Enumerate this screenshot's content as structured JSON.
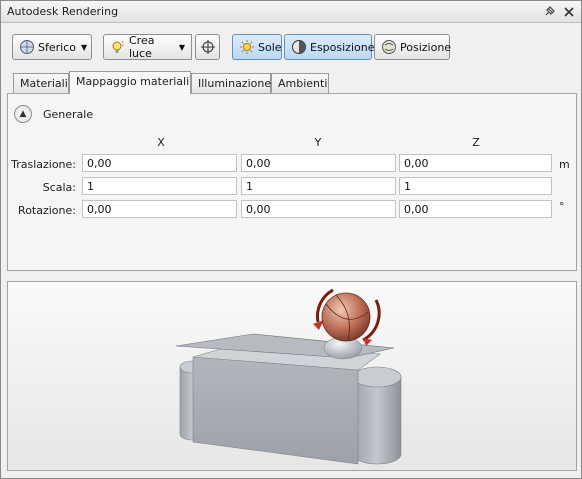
{
  "window": {
    "title": "Autodesk Rendering"
  },
  "titlebar_icons": [
    "pin-icon",
    "close-icon"
  ],
  "toolbar": {
    "sferico_label": "Sferico",
    "crea_luce_label": "Crea luce",
    "sole_label": "Sole",
    "esposizione_label": "Esposizione",
    "posizione_label": "Posizione"
  },
  "tabs": [
    {
      "label": "Materiali"
    },
    {
      "label": "Mappaggio materiali"
    },
    {
      "label": "Illuminazione"
    },
    {
      "label": "Ambienti"
    }
  ],
  "selected_tab": "Mappaggio materiali",
  "section": {
    "title": "Generale"
  },
  "columns": [
    "X",
    "Y",
    "Z"
  ],
  "rows": [
    {
      "label": "Traslazione:",
      "x": "0,00",
      "y": "0,00",
      "z": "0,00",
      "unit": "m"
    },
    {
      "label": "Scala:",
      "x": "1",
      "y": "1",
      "z": "1",
      "unit": ""
    },
    {
      "label": "Rotazione:",
      "x": "0,00",
      "y": "0,00",
      "z": "0,00",
      "unit": "°"
    }
  ],
  "colors": {
    "active_button": "#b9d8f6",
    "sphere": "#b8644a",
    "model_gray": "#a9adb5"
  }
}
